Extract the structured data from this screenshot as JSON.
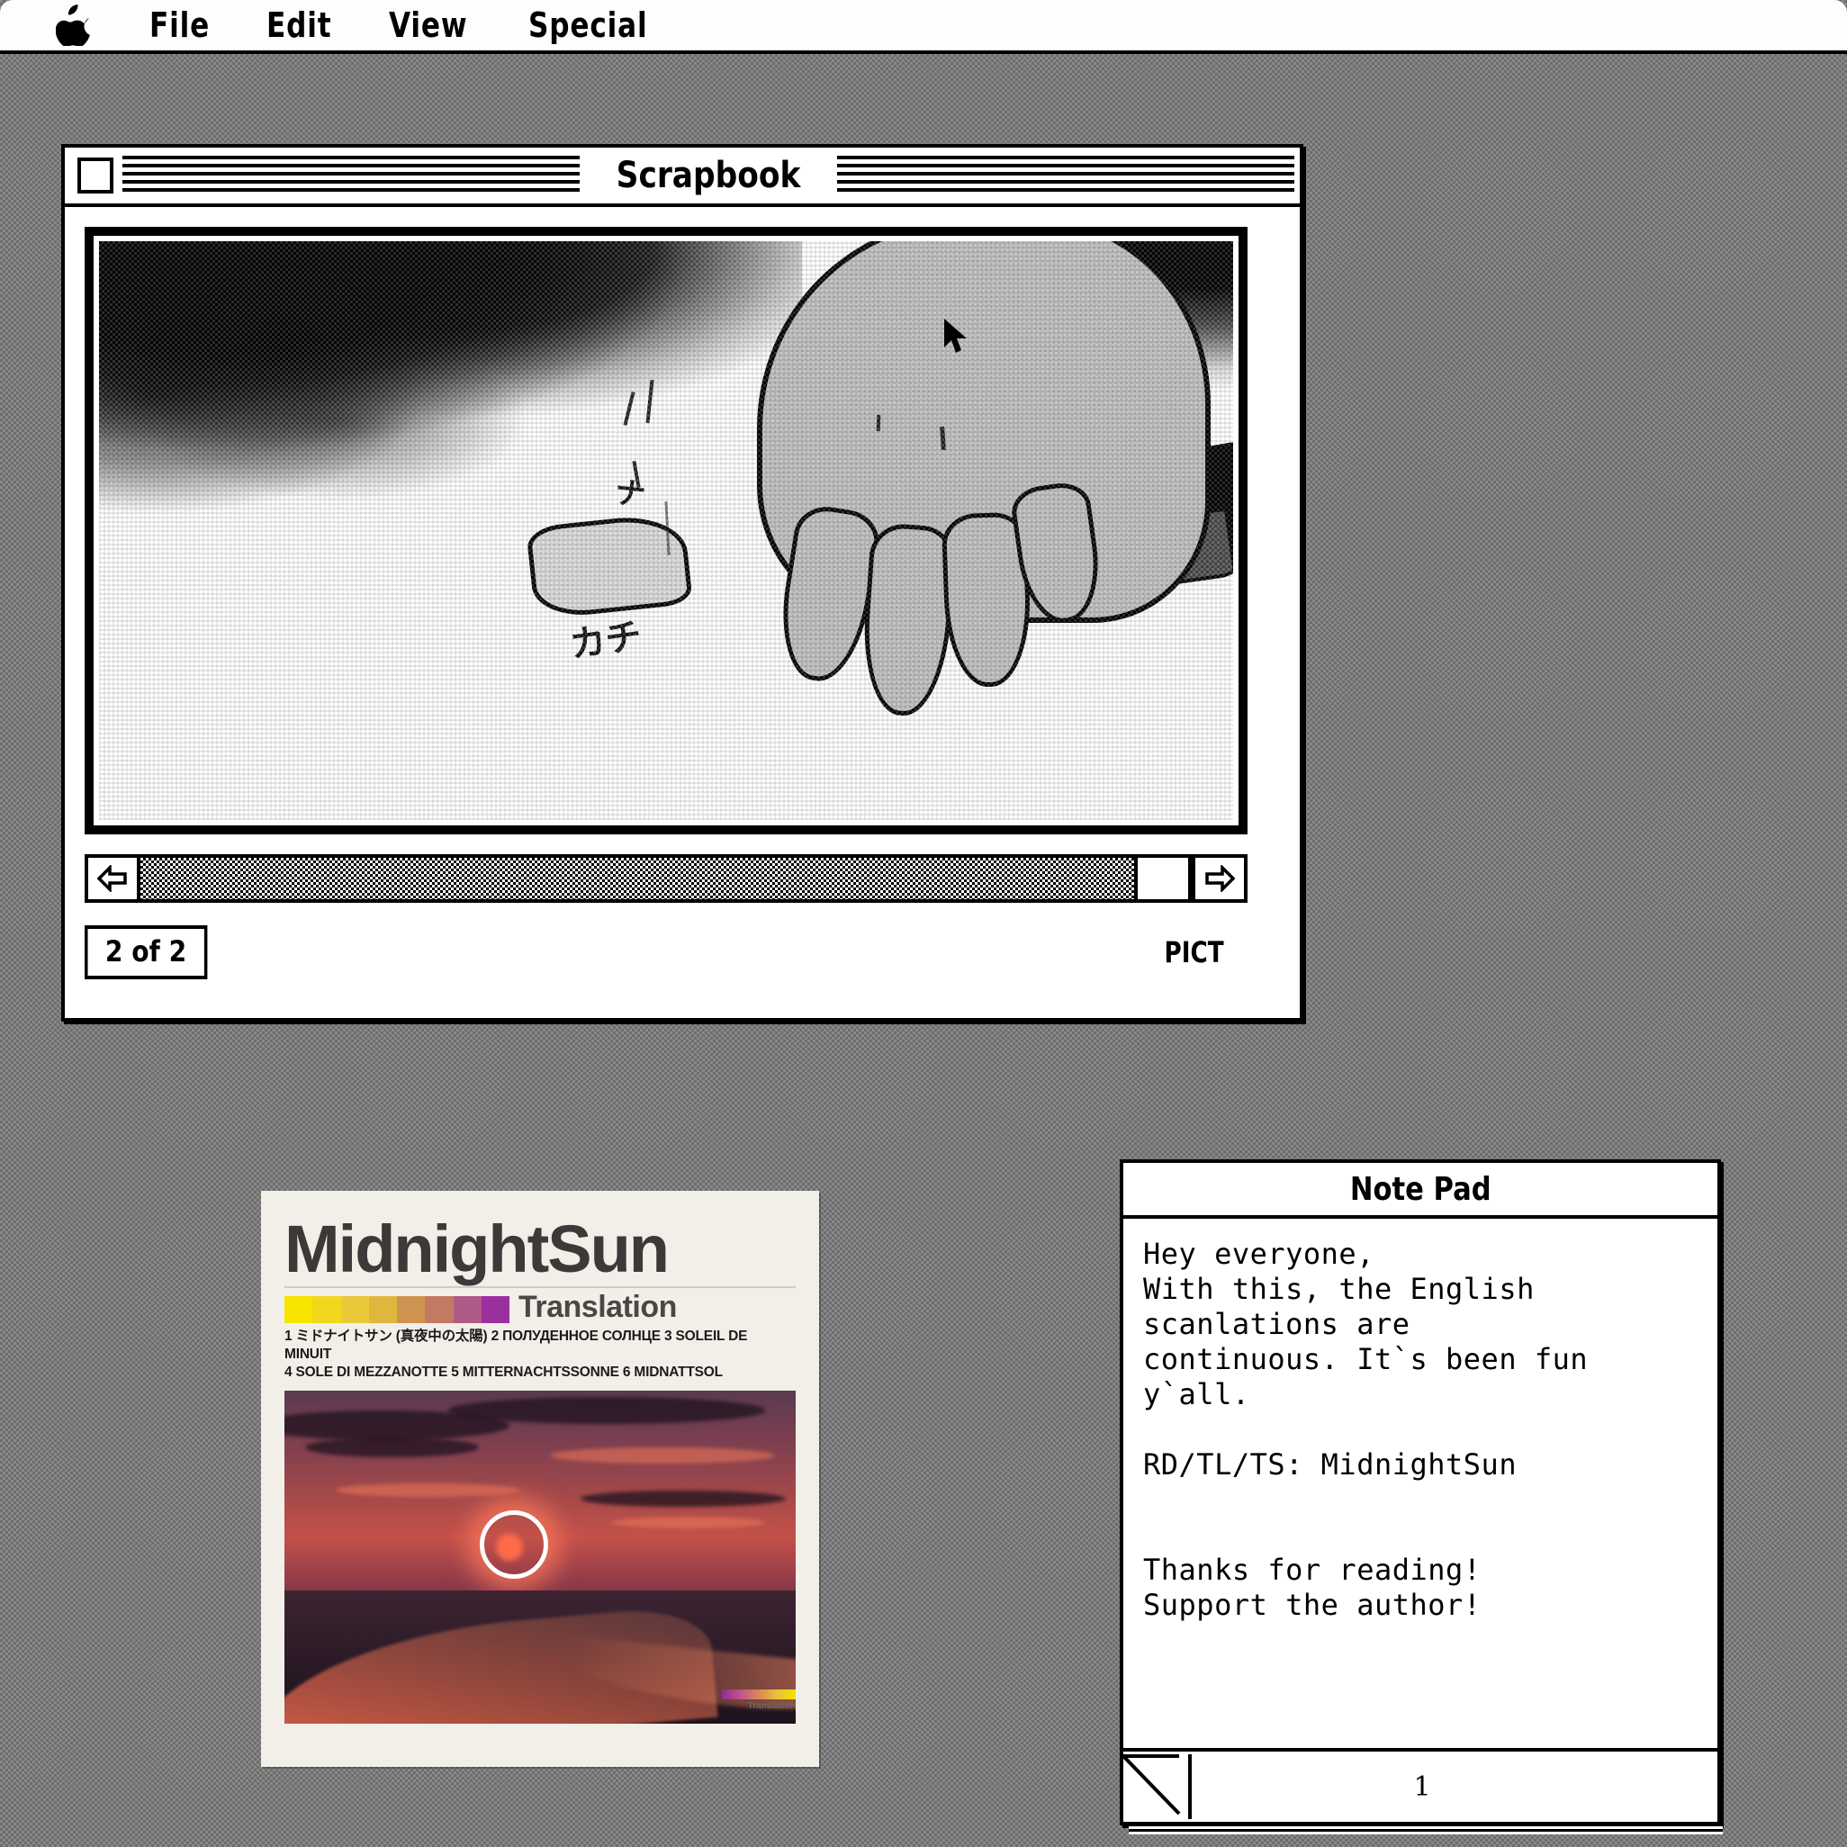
{
  "menubar": {
    "apple_icon": "apple-logo-icon",
    "items": [
      {
        "label": "File"
      },
      {
        "label": "Edit"
      },
      {
        "label": "View"
      },
      {
        "label": "Special"
      }
    ]
  },
  "scrapbook": {
    "title": "Scrapbook",
    "close_box": "close-box",
    "page_counter": "2 of 2",
    "data_type": "PICT",
    "scrollbar": {
      "left_arrow": "arrow-left-icon",
      "right_arrow": "arrow-right-icon",
      "thumb_position": "right"
    },
    "artwork": {
      "description": "High-contrast dithered manga panel: a hand reaching down over a dark smoky sky",
      "japanese_glyph_1": "カチ",
      "japanese_glyph_2": "ナ"
    }
  },
  "poster": {
    "title": "MidnightSun",
    "subtitle": "Translation",
    "languages_line_1": "1 ミドナイトサン (真夜中の太陽) 2 ПОЛУДЕННОЕ СОЛНЦЕ 3 SOLEIL DE MINUIT",
    "languages_line_2": "4 SOLE DI MEZZANOTTE 5 MITTERNACHTSSONNE 6 MIDNATTSOL",
    "footer_label": "Translation",
    "swatches": [
      "#f7e500",
      "#f0d91c",
      "#e8c93a",
      "#dfb63e",
      "#cf9350",
      "#c27a63",
      "#b05a88",
      "#9c2f9e"
    ],
    "image_alt": "Sunset over a highway with a glowing red sun ring"
  },
  "notepad": {
    "title": "Note Pad",
    "text": "Hey everyone,\nWith this, the English\nscanlations are\ncontinuous. It`s been fun\ny`all.\n\nRD/TL/TS: MidnightSun\n\n\nThanks for reading!\nSupport the author!",
    "page_number": "1",
    "page_corner": "page-turn-corner-icon"
  },
  "colors": {
    "desktop": "#888888",
    "window_bg": "#ffffff",
    "ink": "#000000",
    "poster_bg": "#f2efe9",
    "poster_ink": "#3c3a38"
  }
}
